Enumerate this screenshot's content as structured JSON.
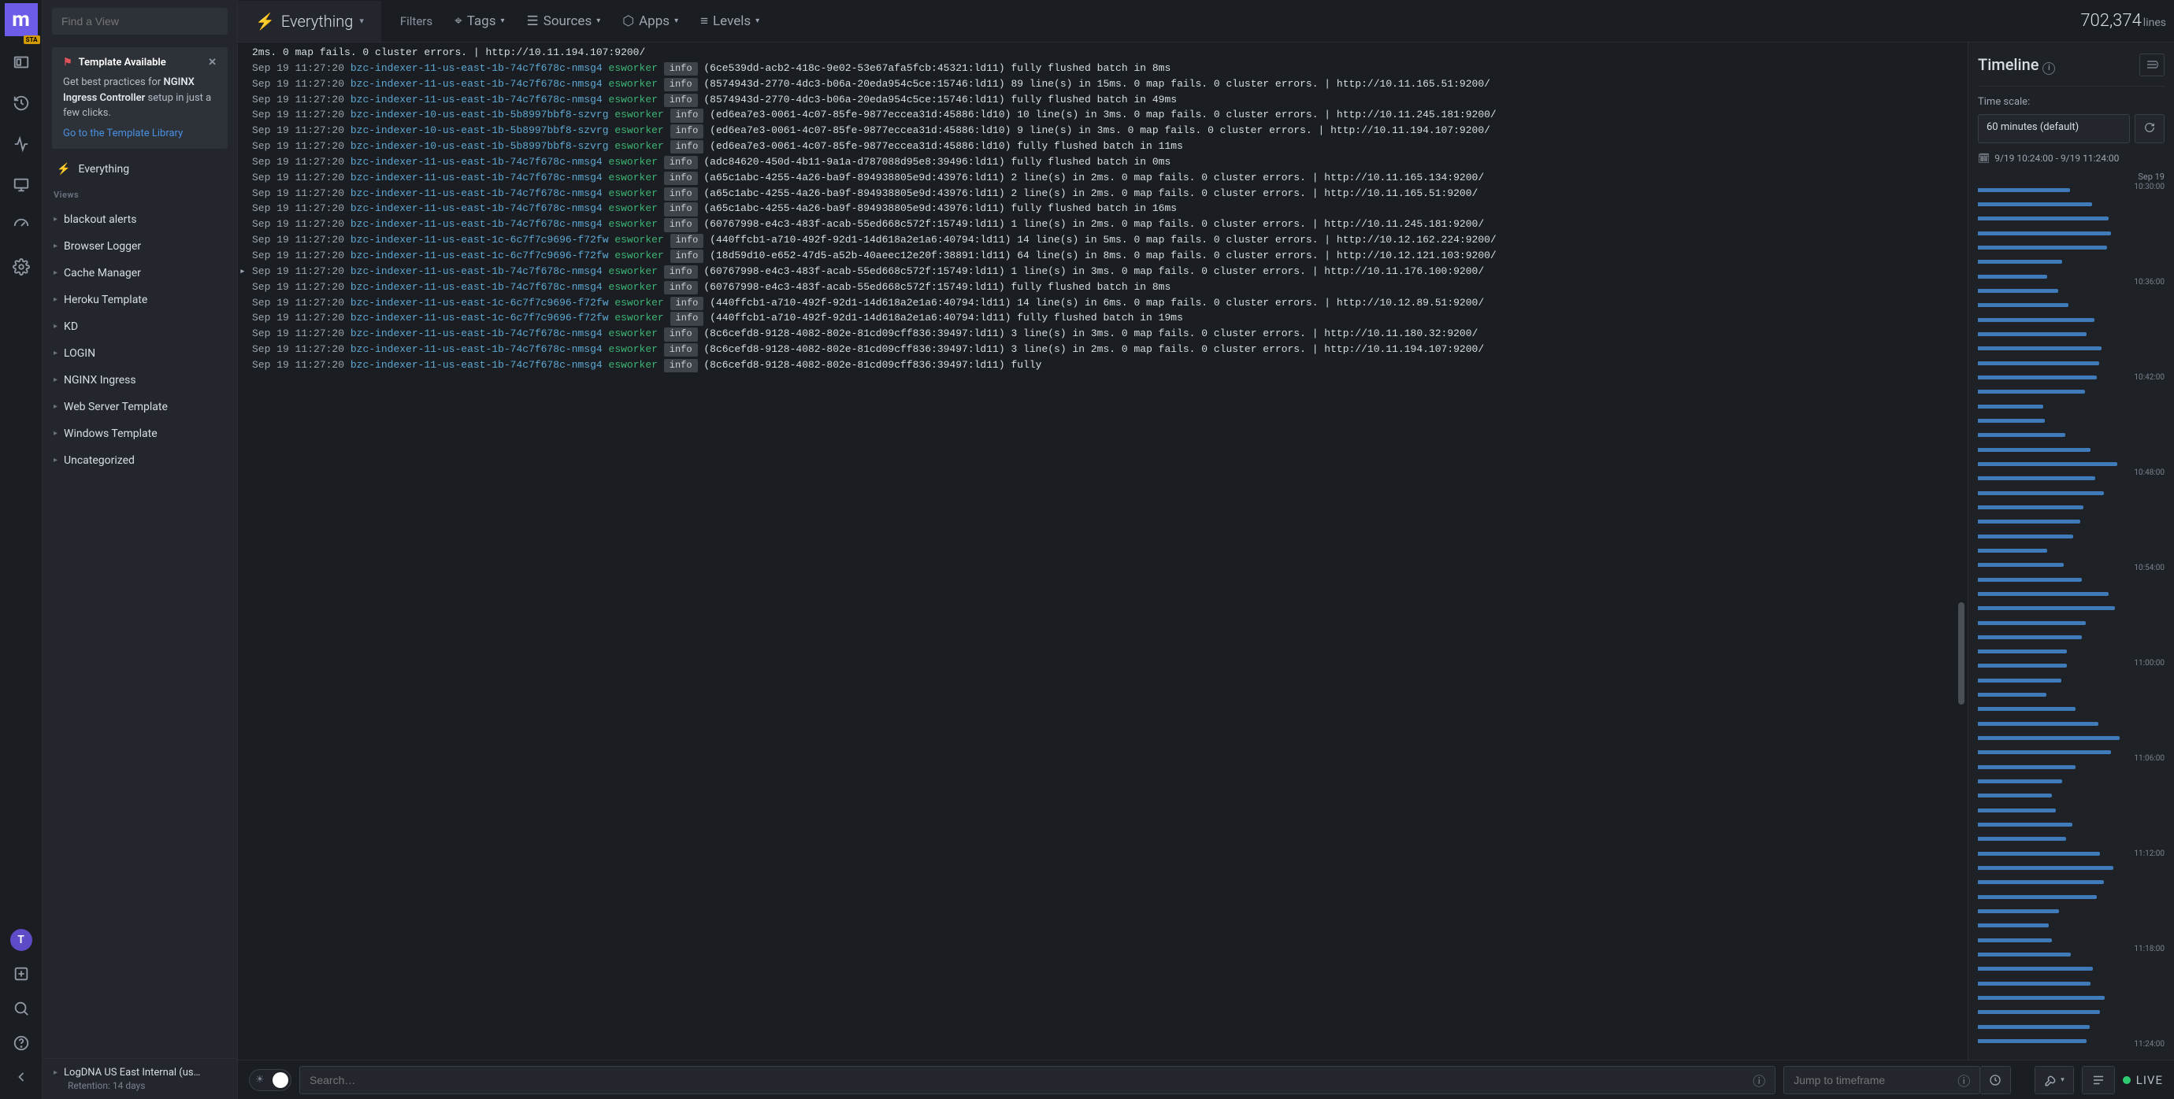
{
  "brand": {
    "letter": "m",
    "badge": "STA"
  },
  "search_view_placeholder": "Find a View",
  "template_card": {
    "title": "Template Available",
    "body_pre": "Get best practices for ",
    "body_bold": "NGINX Ingress Controller",
    "body_post": " setup in just a few clicks.",
    "link": "Go to the Template Library"
  },
  "everything_label": "Everything",
  "views_header": "Views",
  "views": [
    {
      "label": "blackout alerts"
    },
    {
      "label": "Browser Logger"
    },
    {
      "label": "Cache Manager"
    },
    {
      "label": "Heroku Template"
    },
    {
      "label": "KD"
    },
    {
      "label": "LOGIN"
    },
    {
      "label": "NGINX Ingress"
    },
    {
      "label": "Web Server Template"
    },
    {
      "label": "Windows Template"
    },
    {
      "label": "Uncategorized"
    }
  ],
  "source_footer": {
    "name": "LogDNA US East Internal (us…",
    "retention": "Retention: 14 days"
  },
  "avatar_letter": "T",
  "topbar": {
    "active_tab": "Everything",
    "filters_label": "Filters",
    "items": [
      "Tags",
      "Sources",
      "Apps",
      "Levels"
    ],
    "line_count_num": "702,374",
    "line_count_label": "lines"
  },
  "logs": [
    {
      "ts": "",
      "src": "",
      "wrk": "",
      "lvl": "",
      "msg": "2ms. 0 map fails. 0 cluster errors. | http://10.11.194.107:9200/",
      "cont": true
    },
    {
      "ts": "Sep 19 11:27:20",
      "src": "bzc-indexer-11-us-east-1b-74c7f678c-nmsg4",
      "wrk": "esworker",
      "lvl": "info",
      "msg": "(6ce539dd-acb2-418c-9e02-53e67afa5fcb:45321:ld11) fully flushed batch in 8ms"
    },
    {
      "ts": "Sep 19 11:27:20",
      "src": "bzc-indexer-11-us-east-1b-74c7f678c-nmsg4",
      "wrk": "esworker",
      "lvl": "info",
      "msg": "(8574943d-2770-4dc3-b06a-20eda954c5ce:15746:ld11) 89 line(s) in 15ms. 0 map fails. 0 cluster errors. | http://10.11.165.51:9200/"
    },
    {
      "ts": "Sep 19 11:27:20",
      "src": "bzc-indexer-11-us-east-1b-74c7f678c-nmsg4",
      "wrk": "esworker",
      "lvl": "info",
      "msg": "(8574943d-2770-4dc3-b06a-20eda954c5ce:15746:ld11) fully flushed batch in 49ms"
    },
    {
      "ts": "Sep 19 11:27:20",
      "src": "bzc-indexer-10-us-east-1b-5b8997bbf8-szvrg",
      "wrk": "esworker",
      "lvl": "info",
      "msg": "(ed6ea7e3-0061-4c07-85fe-9877eccea31d:45886:ld10) 10 line(s) in 3ms. 0 map fails. 0 cluster errors. | http://10.11.245.181:9200/"
    },
    {
      "ts": "Sep 19 11:27:20",
      "src": "bzc-indexer-10-us-east-1b-5b8997bbf8-szvrg",
      "wrk": "esworker",
      "lvl": "info",
      "msg": "(ed6ea7e3-0061-4c07-85fe-9877eccea31d:45886:ld10) 9 line(s) in 3ms. 0 map fails. 0 cluster errors. | http://10.11.194.107:9200/"
    },
    {
      "ts": "Sep 19 11:27:20",
      "src": "bzc-indexer-10-us-east-1b-5b8997bbf8-szvrg",
      "wrk": "esworker",
      "lvl": "info",
      "msg": "(ed6ea7e3-0061-4c07-85fe-9877eccea31d:45886:ld10) fully flushed batch in 11ms"
    },
    {
      "ts": "Sep 19 11:27:20",
      "src": "bzc-indexer-11-us-east-1b-74c7f678c-nmsg4",
      "wrk": "esworker",
      "lvl": "info",
      "msg": "(adc84620-450d-4b11-9a1a-d787088d95e8:39496:ld11) fully flushed batch in 0ms"
    },
    {
      "ts": "Sep 19 11:27:20",
      "src": "bzc-indexer-11-us-east-1b-74c7f678c-nmsg4",
      "wrk": "esworker",
      "lvl": "info",
      "msg": "(a65c1abc-4255-4a26-ba9f-894938805e9d:43976:ld11) 2 line(s) in 2ms. 0 map fails. 0 cluster errors. | http://10.11.165.134:9200/"
    },
    {
      "ts": "Sep 19 11:27:20",
      "src": "bzc-indexer-11-us-east-1b-74c7f678c-nmsg4",
      "wrk": "esworker",
      "lvl": "info",
      "msg": "(a65c1abc-4255-4a26-ba9f-894938805e9d:43976:ld11) 2 line(s) in 2ms. 0 map fails. 0 cluster errors. | http://10.11.165.51:9200/"
    },
    {
      "ts": "Sep 19 11:27:20",
      "src": "bzc-indexer-11-us-east-1b-74c7f678c-nmsg4",
      "wrk": "esworker",
      "lvl": "info",
      "msg": "(a65c1abc-4255-4a26-ba9f-894938805e9d:43976:ld11) fully flushed batch in 16ms"
    },
    {
      "ts": "Sep 19 11:27:20",
      "src": "bzc-indexer-11-us-east-1b-74c7f678c-nmsg4",
      "wrk": "esworker",
      "lvl": "info",
      "msg": "(60767998-e4c3-483f-acab-55ed668c572f:15749:ld11) 1 line(s) in 2ms. 0 map fails. 0 cluster errors. | http://10.11.245.181:9200/"
    },
    {
      "ts": "Sep 19 11:27:20",
      "src": "bzc-indexer-11-us-east-1c-6c7f7c9696-f72fw",
      "wrk": "esworker",
      "lvl": "info",
      "msg": "(440ffcb1-a710-492f-92d1-14d618a2e1a6:40794:ld11) 14 line(s) in 5ms. 0 map fails. 0 cluster errors. | http://10.12.162.224:9200/"
    },
    {
      "ts": "Sep 19 11:27:20",
      "src": "bzc-indexer-11-us-east-1c-6c7f7c9696-f72fw",
      "wrk": "esworker",
      "lvl": "info",
      "msg": "(18d59d10-e652-47d5-a52b-40aeec12e20f:38891:ld11) 64 line(s) in 8ms. 0 map fails. 0 cluster errors. | http://10.12.121.103:9200/"
    },
    {
      "ts": "Sep 19 11:27:20",
      "src": "bzc-indexer-11-us-east-1b-74c7f678c-nmsg4",
      "wrk": "esworker",
      "lvl": "info",
      "msg": "(60767998-e4c3-483f-acab-55ed668c572f:15749:ld11) 1 line(s) in 3ms. 0 map fails. 0 cluster errors. | http://10.11.176.100:9200/",
      "selected": true
    },
    {
      "ts": "Sep 19 11:27:20",
      "src": "bzc-indexer-11-us-east-1b-74c7f678c-nmsg4",
      "wrk": "esworker",
      "lvl": "info",
      "msg": "(60767998-e4c3-483f-acab-55ed668c572f:15749:ld11) fully flushed batch in 8ms"
    },
    {
      "ts": "Sep 19 11:27:20",
      "src": "bzc-indexer-11-us-east-1c-6c7f7c9696-f72fw",
      "wrk": "esworker",
      "lvl": "info",
      "msg": "(440ffcb1-a710-492f-92d1-14d618a2e1a6:40794:ld11) 14 line(s) in 6ms. 0 map fails. 0 cluster errors. | http://10.12.89.51:9200/"
    },
    {
      "ts": "Sep 19 11:27:20",
      "src": "bzc-indexer-11-us-east-1c-6c7f7c9696-f72fw",
      "wrk": "esworker",
      "lvl": "info",
      "msg": "(440ffcb1-a710-492f-92d1-14d618a2e1a6:40794:ld11) fully flushed batch in 19ms"
    },
    {
      "ts": "Sep 19 11:27:20",
      "src": "bzc-indexer-11-us-east-1b-74c7f678c-nmsg4",
      "wrk": "esworker",
      "lvl": "info",
      "msg": "(8c6cefd8-9128-4082-802e-81cd09cff836:39497:ld11) 3 line(s) in 3ms. 0 map fails. 0 cluster errors. | http://10.11.180.32:9200/"
    },
    {
      "ts": "Sep 19 11:27:20",
      "src": "bzc-indexer-11-us-east-1b-74c7f678c-nmsg4",
      "wrk": "esworker",
      "lvl": "info",
      "msg": "(8c6cefd8-9128-4082-802e-81cd09cff836:39497:ld11) 3 line(s) in 2ms. 0 map fails. 0 cluster errors. | http://10.11.194.107:9200/"
    },
    {
      "ts": "Sep 19 11:27:20",
      "src": "bzc-indexer-11-us-east-1b-74c7f678c-nmsg4",
      "wrk": "esworker",
      "lvl": "info",
      "msg": "(8c6cefd8-9128-4082-802e-81cd09cff836:39497:ld11) fully"
    }
  ],
  "timeline": {
    "title": "Timeline",
    "time_scale_label": "Time scale:",
    "scale_value": "60 minutes (default)",
    "range": "9/19 10:24:00 - 9/19 11:24:00",
    "day_label": "Sep 19",
    "ticks": [
      "10:30:00",
      "10:36:00",
      "10:42:00",
      "10:48:00",
      "10:54:00",
      "11:00:00",
      "11:06:00",
      "11:12:00",
      "11:18:00",
      "11:24:00"
    ]
  },
  "bottom": {
    "search_placeholder": "Search…",
    "jump_placeholder": "Jump to timeframe",
    "live_label": "LIVE"
  }
}
